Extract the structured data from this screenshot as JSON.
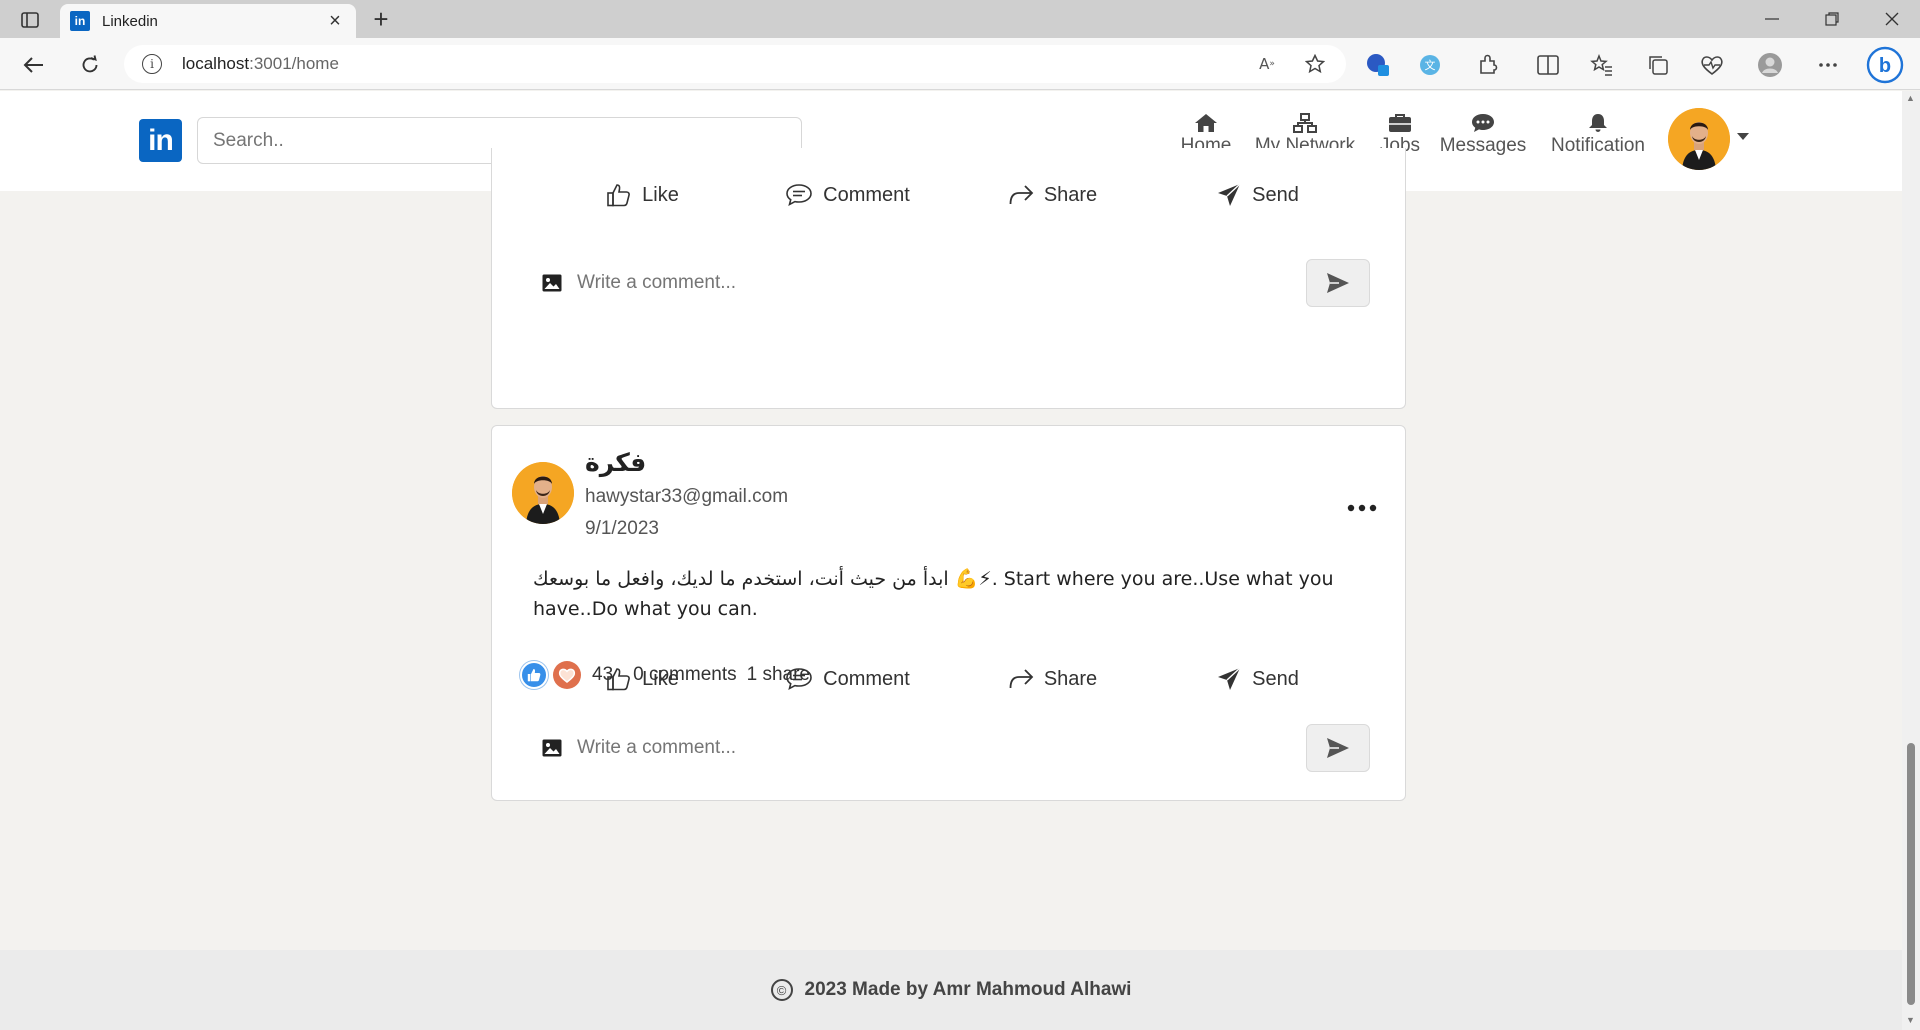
{
  "browser": {
    "tab_title": "Linkedin",
    "url_host": "localhost",
    "url_path": ":3001/home"
  },
  "header": {
    "logo_text": "in",
    "search_placeholder": "Search..",
    "nav": [
      {
        "label": "Home",
        "icon": "home-icon"
      },
      {
        "label": "My Network",
        "icon": "network-icon"
      },
      {
        "label": "Jobs",
        "icon": "briefcase-icon"
      },
      {
        "label": "Messages",
        "icon": "chat-icon"
      },
      {
        "label": "Notification",
        "icon": "bell-icon"
      }
    ]
  },
  "actions": {
    "like": "Like",
    "comment": "Comment",
    "share": "Share",
    "send": "Send"
  },
  "comment_placeholder": "Write a comment...",
  "post": {
    "author": "فكرة",
    "email": "hawystar33@gmail.com",
    "date": "9/1/2023",
    "text": "ابدأ من حيث أنت، استخدم ما لديك، وافعل ما بوسعك 💪⚡. Start where you are..Use what you have..Do what you can.",
    "reaction_count": "43",
    "comments": "0 comments",
    "shares": "1 share"
  },
  "footer": {
    "copyright_symbol": "©",
    "text": "2023 Made by Amr Mahmoud Alhawi"
  },
  "colors": {
    "brand": "#0a66c2",
    "avatar_bg": "#f5a623"
  }
}
